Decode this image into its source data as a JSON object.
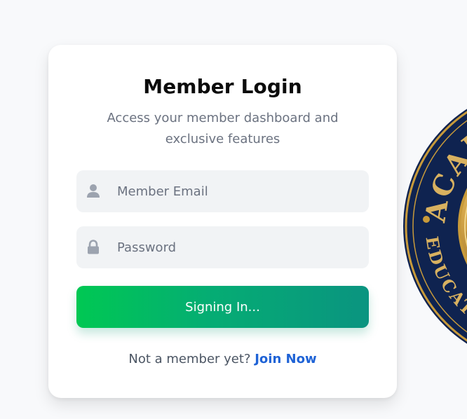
{
  "login": {
    "title": "Member Login",
    "subtitle": "Access your member dashboard and exclusive features",
    "email_placeholder": "Member Email",
    "password_placeholder": "Password",
    "submit_label": "Signing In...",
    "footer_prompt": "Not a member yet?",
    "join_link": "Join Now"
  },
  "icons": {
    "email_field": "user-icon",
    "password_field": "lock-icon"
  },
  "seal": {
    "top_text": "ACAD",
    "bottom_text": "EDUCATIO"
  },
  "colors": {
    "button_start": "#00c853",
    "button_end": "#0a9480",
    "link": "#1f63d6",
    "seal_navy": "#0f2350",
    "seal_gold": "#c89a3a"
  }
}
